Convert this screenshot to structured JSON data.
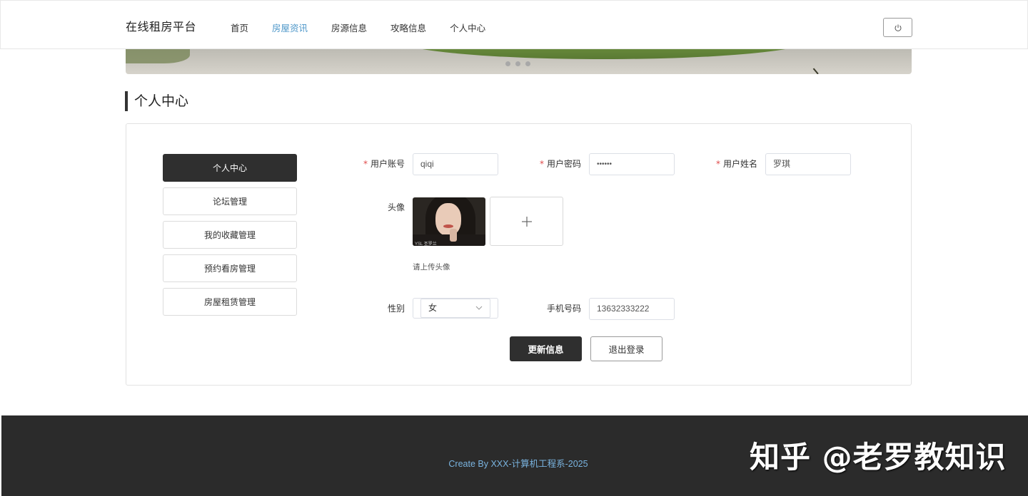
{
  "header": {
    "logo": "在线租房平台",
    "nav": [
      "首页",
      "房屋资讯",
      "房源信息",
      "攻略信息",
      "个人中心"
    ],
    "active_nav": "房屋资讯"
  },
  "section": {
    "title": "个人中心"
  },
  "sidebar": {
    "items": [
      {
        "label": "个人中心",
        "active": true
      },
      {
        "label": "论坛管理",
        "active": false
      },
      {
        "label": "我的收藏管理",
        "active": false
      },
      {
        "label": "预约看房管理",
        "active": false
      },
      {
        "label": "房屋租赁管理",
        "active": false
      }
    ]
  },
  "form": {
    "account": {
      "label": "用户账号",
      "value": "qiqi",
      "required": "*"
    },
    "password": {
      "label": "用户密码",
      "value": "••••••",
      "required": "*"
    },
    "name": {
      "label": "用户姓名",
      "value": "罗琪",
      "required": "*"
    },
    "avatar": {
      "label": "头像",
      "hint": "请上传头像",
      "image_caption": "YSL 圣罗兰"
    },
    "gender": {
      "label": "性别",
      "value": "女"
    },
    "phone": {
      "label": "手机号码",
      "value": "13632333222"
    },
    "submit_label": "更新信息",
    "logout_label": "退出登录"
  },
  "footer": {
    "text": "Create By XXX-计算机工程系-2025"
  },
  "watermark": "知乎 @老罗教知识"
}
